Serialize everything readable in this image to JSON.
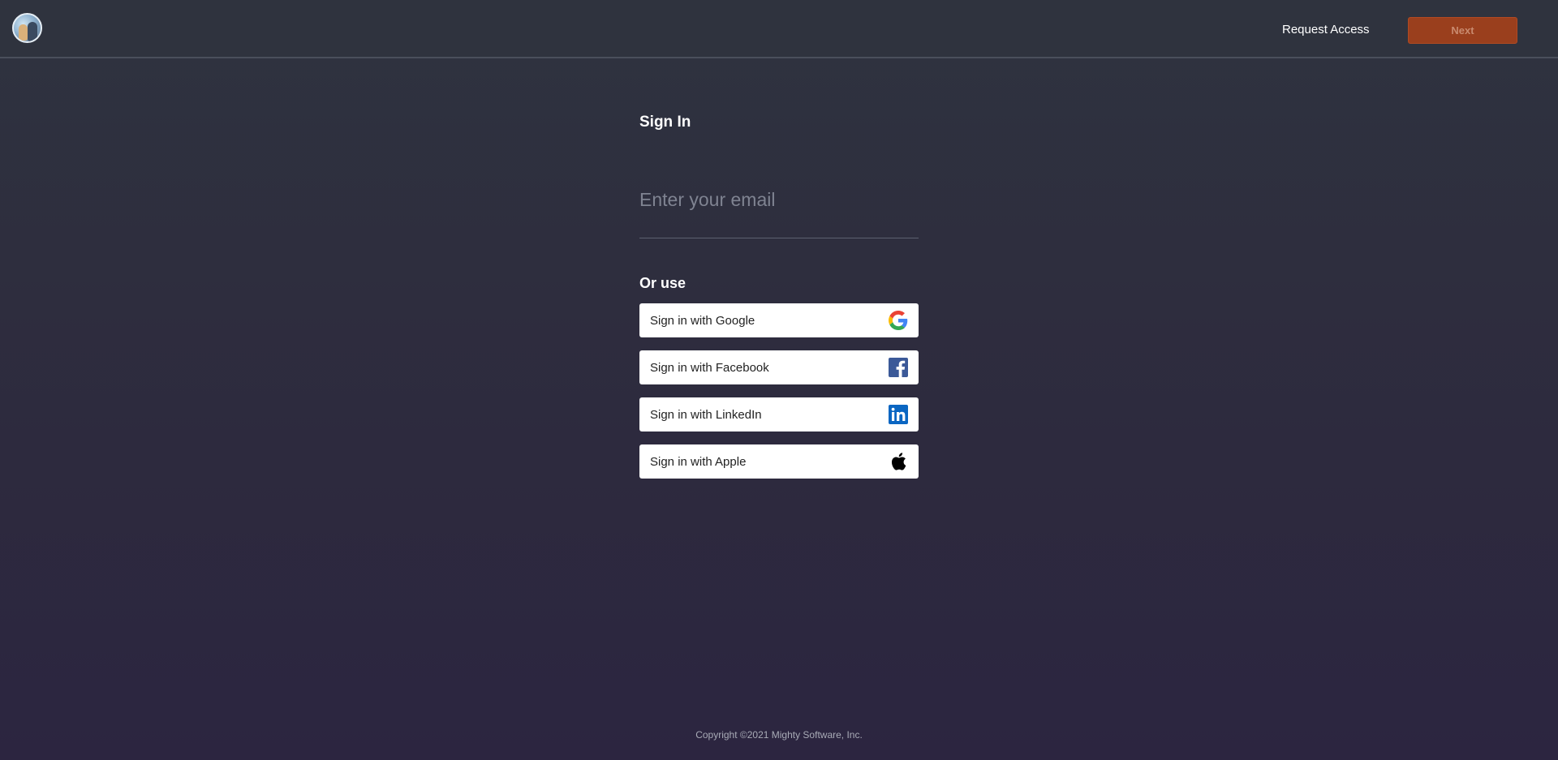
{
  "header": {
    "avatar_icon": "user-avatar",
    "request_access_label": "Request Access",
    "next_label": "Next"
  },
  "signin": {
    "title": "Sign In",
    "email_placeholder": "Enter your email",
    "email_value": "",
    "or_use_label": "Or use",
    "providers": [
      {
        "label": "Sign in with Google",
        "icon": "google-icon"
      },
      {
        "label": "Sign in with Facebook",
        "icon": "facebook-icon"
      },
      {
        "label": "Sign in with LinkedIn",
        "icon": "linkedin-icon"
      },
      {
        "label": "Sign in with Apple",
        "icon": "apple-icon"
      }
    ]
  },
  "footer": {
    "copyright": "Copyright ©2021 Mighty Software, Inc."
  },
  "colors": {
    "accent": "#9a3f1d",
    "background": "#2f333e",
    "facebook": "#3b5998",
    "linkedin": "#0a66c2"
  }
}
